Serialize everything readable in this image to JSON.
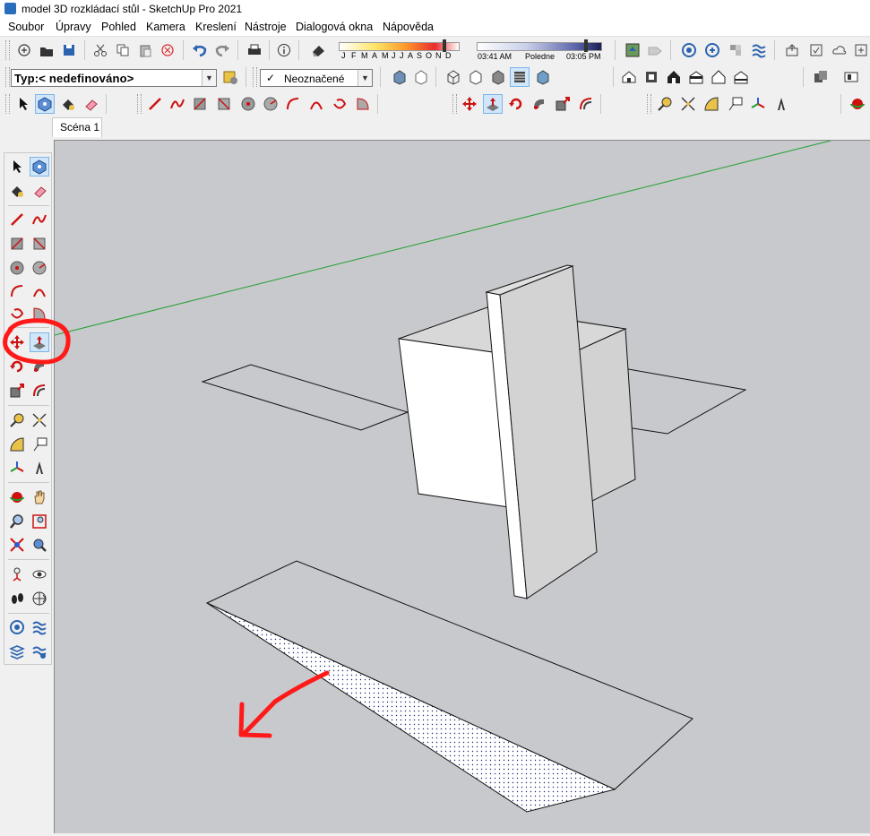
{
  "window": {
    "title": "model 3D rozkládací stůl - SketchUp Pro 2021"
  },
  "menu": [
    "Soubor",
    "Úpravy",
    "Pohled",
    "Kamera",
    "Kreslení",
    "Nástroje",
    "Dialogová okna",
    "Nápověda"
  ],
  "shadow": {
    "months": [
      "J",
      "F",
      "M",
      "A",
      "M",
      "J",
      "J",
      "A",
      "S",
      "O",
      "N",
      "D"
    ],
    "time_start": "03:41 AM",
    "time_mid": "Poledne",
    "time_end": "03:05 PM"
  },
  "tag_combo": {
    "value": "Typ:< nedefinováno>"
  },
  "untagged": {
    "check": "✓",
    "label": "Neoznačené"
  },
  "scene_tab": {
    "label": "Scéna 1"
  },
  "colors": {
    "viewport_bg": "#c8c9cd",
    "green_axis": "#1f9e2c",
    "annotation_red": "#ff1a1a",
    "face_white": "#ffffff",
    "face_grey": "#d2d2d2"
  },
  "icons": {
    "top_row1": [
      "new-icon",
      "open-icon",
      "save-icon",
      "cut-icon",
      "copy-icon",
      "paste-icon",
      "erase-icon",
      "undo-icon",
      "redo-icon",
      "print-icon",
      "model-info-icon",
      "shadow-icon",
      "geo-location-icon",
      "tag-icon",
      "extension-warehouse-icon",
      "3d-warehouse-icon",
      "components-icon",
      "sandbox-icon",
      "share-icon",
      "check-icon",
      "cloud-icon",
      "add-location-icon"
    ],
    "top_row2": [
      "color-by-tag-icon",
      "xray-icon",
      "back-edges-icon",
      "wireframe-icon",
      "hidden-line-icon",
      "shaded-icon",
      "textured-icon",
      "monochrome-icon",
      "iso-view-icon",
      "top-view-icon",
      "front-view-icon",
      "right-view-icon",
      "back-view-icon",
      "left-view-icon",
      "section-plane-icon",
      "section-cuts-icon"
    ],
    "top_row3": [
      "select-icon",
      "make-component-icon",
      "paint-bucket-icon",
      "eraser-icon",
      "line-icon",
      "freehand-icon",
      "rectangle-icon",
      "rotated-rectangle-icon",
      "circle-icon",
      "polygon-icon",
      "arc-icon",
      "2pt-arc-icon",
      "3pt-arc-icon",
      "pie-icon",
      "move-icon",
      "push-pull-icon",
      "rotate-icon",
      "follow-me-icon",
      "scale-icon",
      "offset-icon",
      "tape-measure-icon",
      "dimensions-icon",
      "protractor-icon",
      "text-icon",
      "axes-icon",
      "3d-text-icon",
      "orbit-icon"
    ],
    "left": [
      "select-icon",
      "make-component-icon",
      "paint-bucket-icon",
      "eraser-icon",
      "line-icon",
      "freehand-icon",
      "rectangle-icon",
      "rotated-rectangle-icon",
      "circle-icon",
      "polygon-icon",
      "arc-icon",
      "2pt-arc-icon",
      "3pt-arc-icon",
      "pie-icon",
      "move-icon",
      "push-pull-icon",
      "rotate-icon",
      "follow-me-icon",
      "scale-icon",
      "offset-icon",
      "tape-measure-icon",
      "dimensions-icon",
      "protractor-icon",
      "text-icon",
      "axes-icon",
      "3d-text-icon",
      "orbit-icon",
      "pan-icon",
      "zoom-icon",
      "zoom-window-icon",
      "zoom-extents-icon",
      "previous-view-icon",
      "position-camera-icon",
      "look-around-icon",
      "walk-icon",
      "section-plane-icon",
      "warehouse-icon",
      "sandbox-icon",
      "layers-icon",
      "sandbox-2-icon"
    ]
  }
}
